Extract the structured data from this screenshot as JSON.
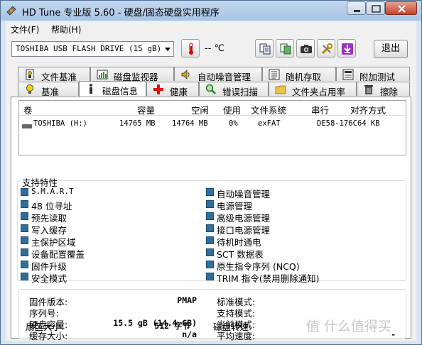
{
  "window": {
    "title": "HD Tune 专业版 5.60 - 硬盘/固态硬盘实用程序"
  },
  "menu": [
    {
      "label": "文件(F)"
    },
    {
      "label": "帮助(H)"
    }
  ],
  "toolbar": {
    "drive": "TOSHIBA USB FLASH DRIVE (15 gB)",
    "temperature": "-- ℃",
    "exit_label": "退出",
    "icons": [
      "thermometer-icon",
      "copy-text-icon",
      "copy-screen-icon",
      "camera-icon",
      "tools-icon",
      "download-icon"
    ]
  },
  "tabs": {
    "row1": [
      {
        "label": "文件基准",
        "icon": "file-benchmark-icon"
      },
      {
        "label": "磁盘监视器",
        "icon": "monitor-icon"
      },
      {
        "label": "自动噪音管理",
        "icon": "speaker-icon"
      },
      {
        "label": "随机存取",
        "icon": "random-access-icon"
      },
      {
        "label": "附加测试",
        "icon": "extra-tests-icon"
      }
    ],
    "row2": [
      {
        "label": "基准",
        "icon": "bulb-icon"
      },
      {
        "label": "磁盘信息",
        "icon": "info-icon",
        "active": true
      },
      {
        "label": "健康",
        "icon": "health-cross-icon"
      },
      {
        "label": "错误扫描",
        "icon": "magnifier-icon"
      },
      {
        "label": "文件夹占用率",
        "icon": "folder-icon"
      },
      {
        "label": "擦除",
        "icon": "trash-icon"
      }
    ]
  },
  "drive_table": {
    "headers": [
      "卷",
      "容量",
      "空闲",
      "使用",
      "文件系统",
      "串行",
      "对齐方式"
    ],
    "rows": [
      [
        "TOSHIBA (H:)",
        "14765 MB",
        "14764 MB",
        "0%",
        "exFAT",
        "DE58-176C",
        "64 KB"
      ]
    ]
  },
  "features": {
    "legend": "支持特性",
    "left": [
      "S.M.A.R.T",
      "48 位寻址",
      "预先读取",
      "写入缓存",
      "主保护区域",
      "设备配置覆盖",
      "固件升级",
      "安全模式"
    ],
    "right": [
      "自动噪音管理",
      "电源管理",
      "高级电源管理",
      "接口电源管理",
      "待机时通电",
      "SCT 数据表",
      "原生指令序列 (NCQ)",
      "TRIM 指令(禁用删除通知)"
    ]
  },
  "info": {
    "left": [
      {
        "label": "固件版本:",
        "value": "PMAP"
      },
      {
        "label": "序列号:",
        "value": ""
      },
      {
        "label": "硬盘容量:",
        "value": "15.5 gB (14.4 GB)"
      },
      {
        "label": "缓存大小:",
        "value": "n/a"
      },
      {
        "label": "扇区大小:",
        "value": "512 字节"
      }
    ],
    "right": [
      {
        "label": "标准模式:",
        "value": ""
      },
      {
        "label": "支持模式:",
        "value": ""
      },
      {
        "label": "当前模式:",
        "value": ""
      },
      {
        "label": "平均速度:",
        "value": "-"
      },
      {
        "label": "磁盘转速:",
        "value": ""
      }
    ]
  },
  "watermark": "值 什么值得买",
  "colors": {
    "checkbox": "#2f6f9e",
    "title_bar": "#b6cfec",
    "close_button": "#c7412b"
  }
}
